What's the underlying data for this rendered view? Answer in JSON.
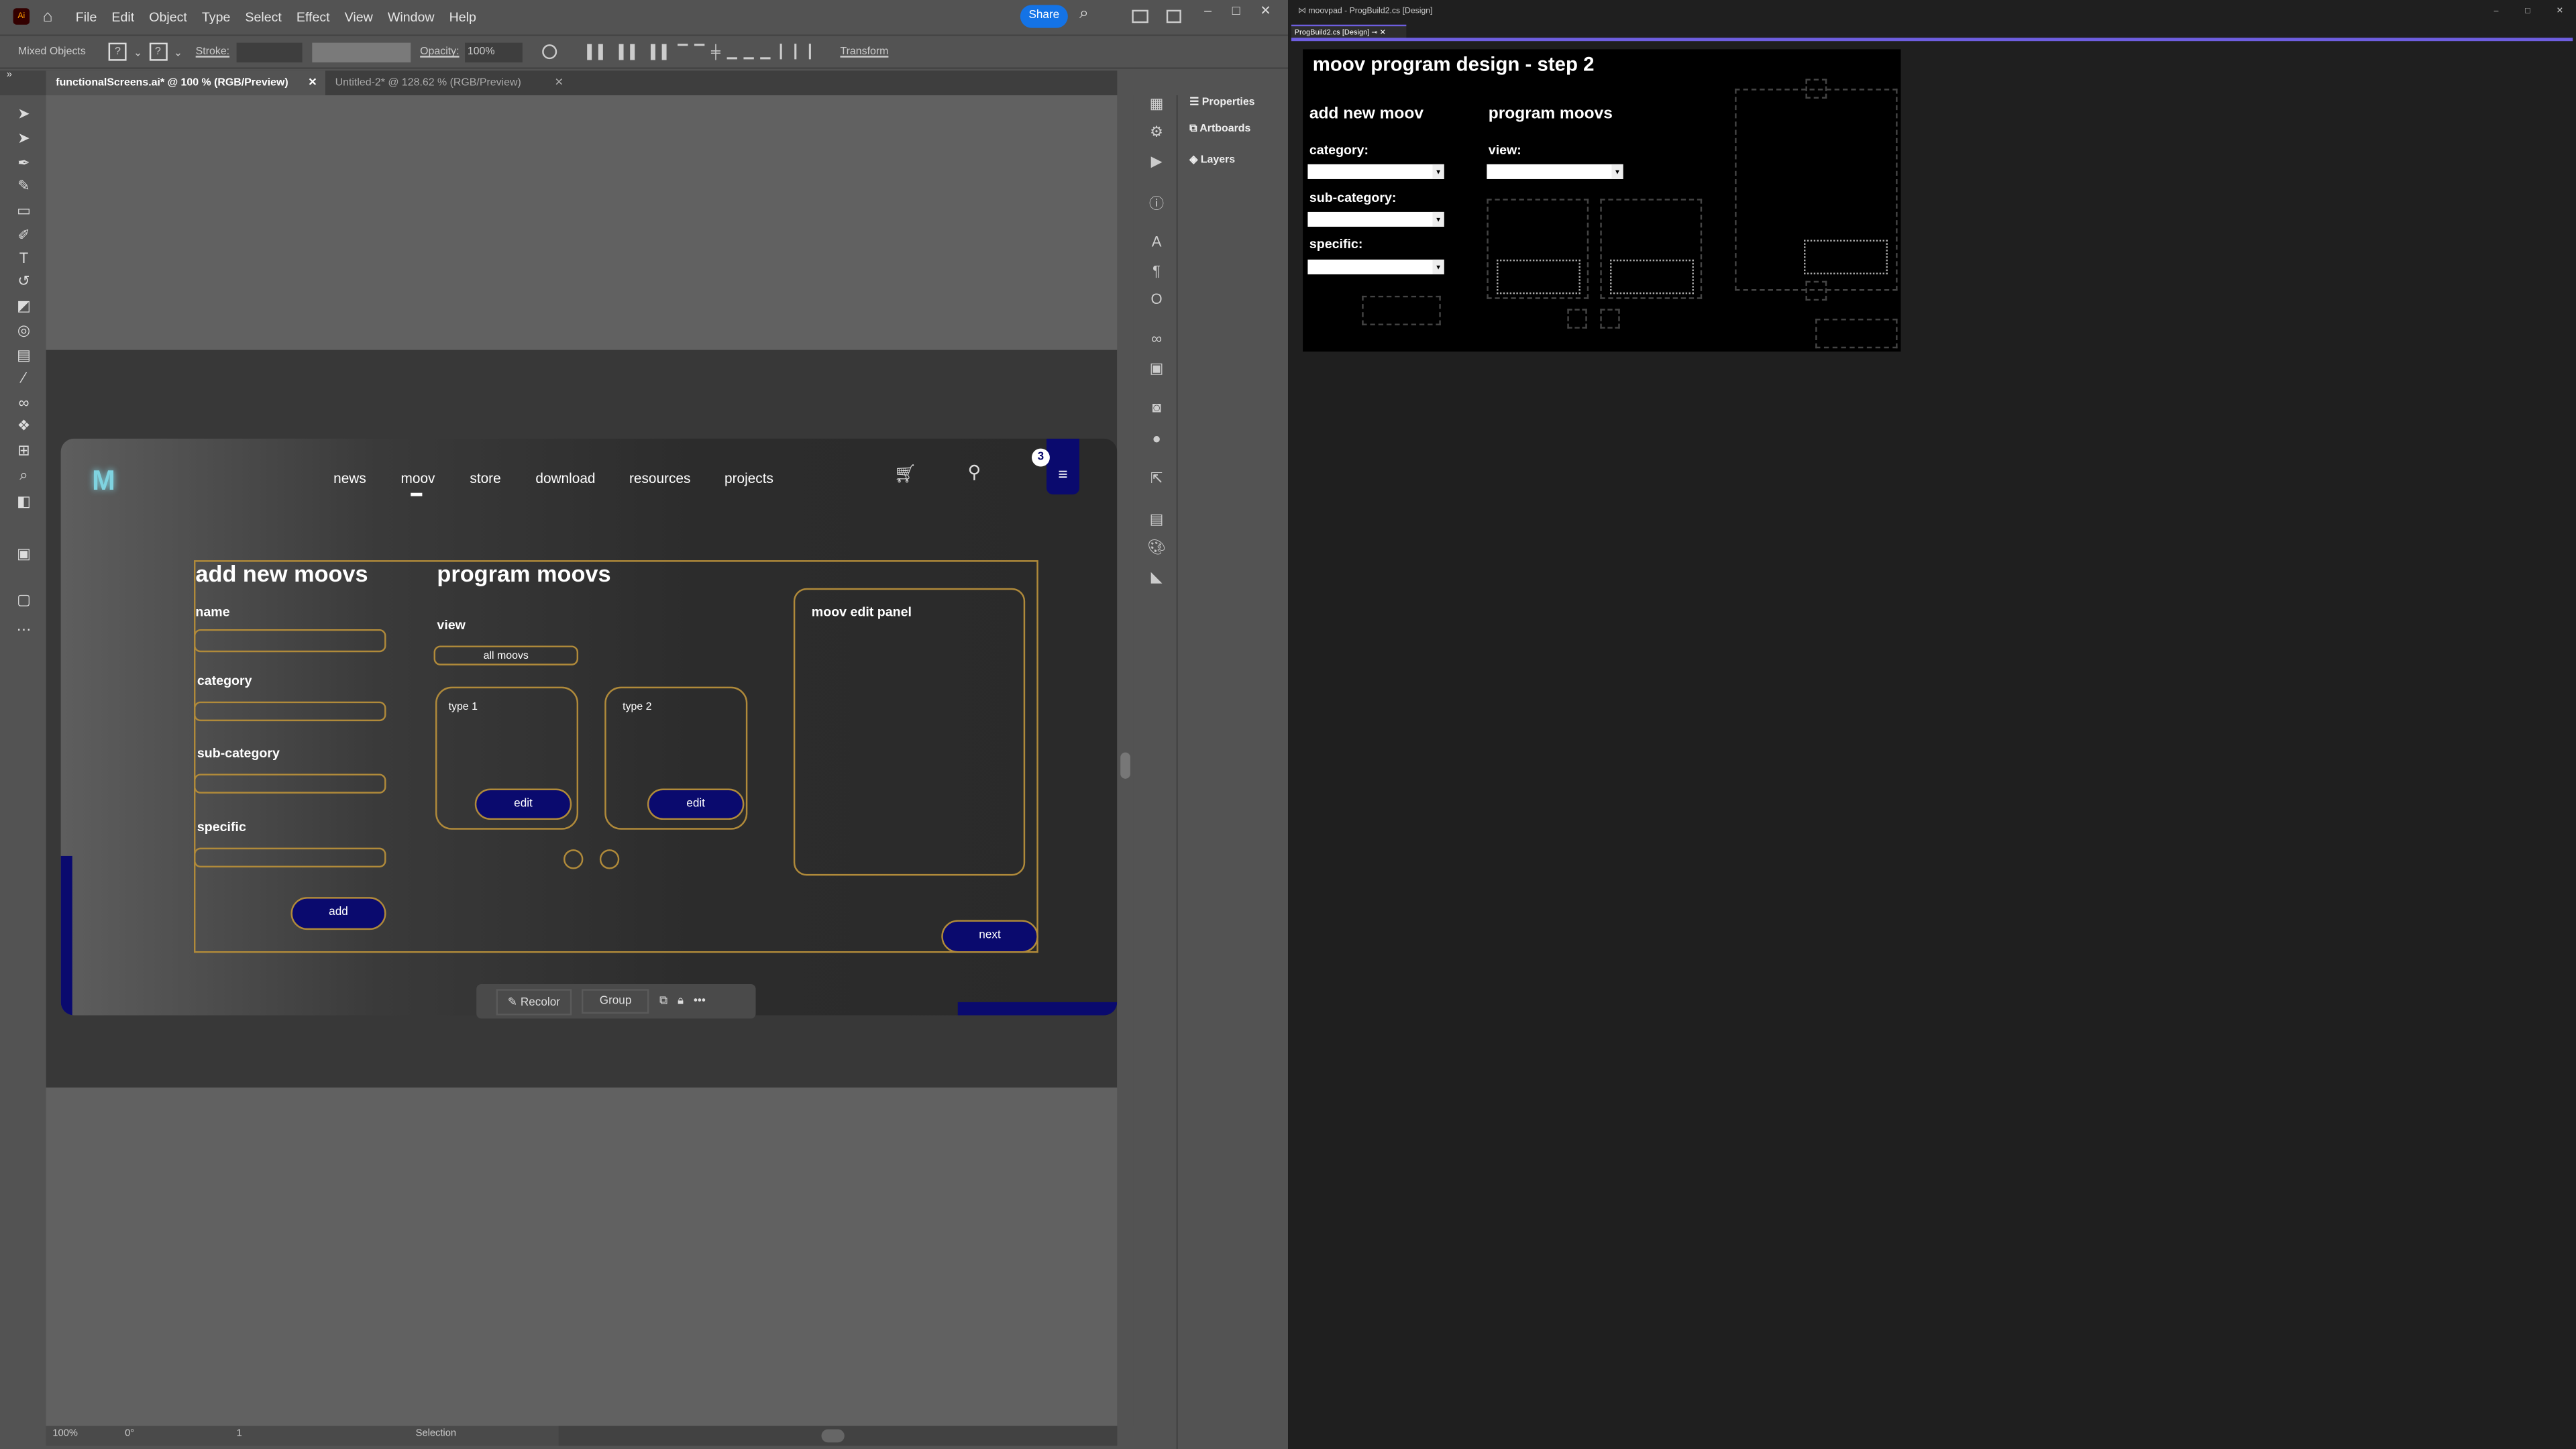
{
  "illustrator": {
    "menu": [
      "File",
      "Edit",
      "Object",
      "Type",
      "Select",
      "Effect",
      "View",
      "Window",
      "Help"
    ],
    "share_label": "Share",
    "control": {
      "mixed_objects": "Mixed Objects",
      "stroke_label": "Stroke:",
      "opacity_label": "Opacity:",
      "opacity_value": "100%",
      "transform_label": "Transform"
    },
    "tabs": [
      {
        "label": "functionalScreens.ai* @ 100 % (RGB/Preview)",
        "active": true
      },
      {
        "label": "Untitled-2* @ 128.62 % (RGB/Preview)",
        "active": false
      }
    ],
    "panels": [
      "Properties",
      "Artboards",
      "Layers"
    ],
    "status": {
      "zoom": "100%",
      "rotation": "0°",
      "artboard": "1",
      "tool": "Selection"
    },
    "context_bar": {
      "recolor": "Recolor",
      "group": "Group"
    }
  },
  "artboard": {
    "nav": [
      "news",
      "moov",
      "store",
      "download",
      "resources",
      "projects"
    ],
    "active_nav": "moov",
    "menu_badge": "3",
    "add_title": "add new moovs",
    "fields": [
      "name",
      "category",
      "sub-category",
      "specific"
    ],
    "add_button": "add",
    "program_title": "program moovs",
    "view_label": "view",
    "view_value": "all moovs",
    "cards": [
      {
        "title": "type 1",
        "button": "edit"
      },
      {
        "title": "type 2",
        "button": "edit"
      }
    ],
    "edit_panel_title": "moov edit panel",
    "next_button": "next",
    "colors": {
      "accent": "#0a0a6e",
      "outline": "#b08a3a",
      "logo": "#7fd3e0"
    }
  },
  "visual_studio": {
    "title": "moovpad - ProgBuild2.cs [Design]",
    "tab": "ProgBuild2.cs [Design]",
    "form": {
      "title": "moov program design - step 2",
      "add_title": "add new moov",
      "labels": [
        "category:",
        "sub-category:",
        "specific:"
      ],
      "program_title": "program moovs",
      "view_label": "view:"
    },
    "accent": "#6e5ee0"
  }
}
